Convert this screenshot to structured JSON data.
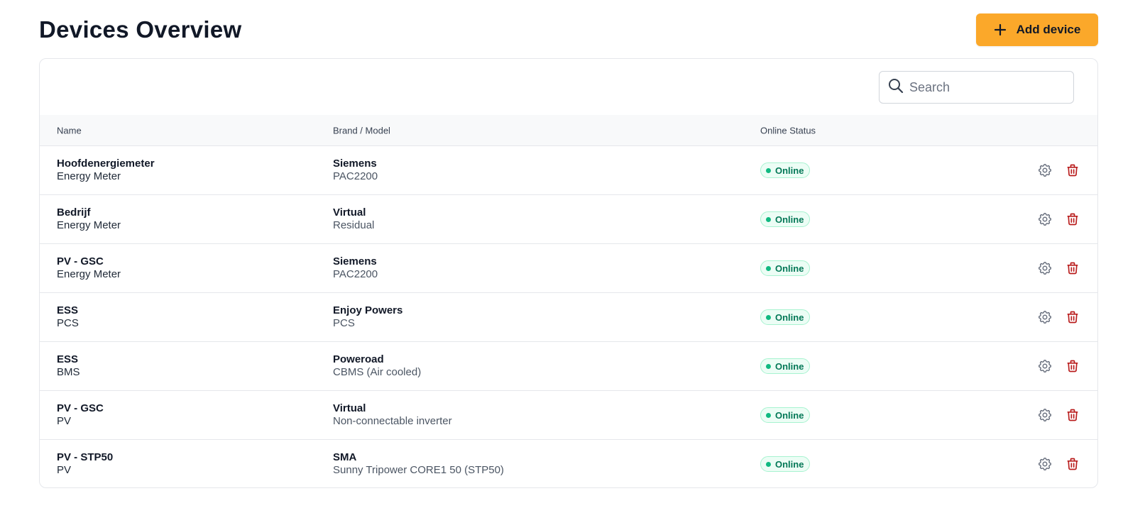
{
  "page": {
    "title": "Devices Overview",
    "add_button_label": "Add device"
  },
  "search": {
    "placeholder": "Search",
    "value": ""
  },
  "table": {
    "headers": {
      "name": "Name",
      "brand_model": "Brand / Model",
      "online_status": "Online Status"
    },
    "rows": [
      {
        "name": "Hoofdenergiemeter",
        "type": "Energy Meter",
        "brand": "Siemens",
        "model": "PAC2200",
        "status": "Online"
      },
      {
        "name": "Bedrijf",
        "type": "Energy Meter",
        "brand": "Virtual",
        "model": "Residual",
        "status": "Online"
      },
      {
        "name": "PV - GSC",
        "type": "Energy Meter",
        "brand": "Siemens",
        "model": "PAC2200",
        "status": "Online"
      },
      {
        "name": "ESS",
        "type": "PCS",
        "brand": "Enjoy Powers",
        "model": "PCS",
        "status": "Online"
      },
      {
        "name": "ESS",
        "type": "BMS",
        "brand": "Poweroad",
        "model": "CBMS (Air cooled)",
        "status": "Online"
      },
      {
        "name": "PV - GSC",
        "type": "PV",
        "brand": "Virtual",
        "model": "Non-connectable inverter",
        "status": "Online"
      },
      {
        "name": "PV - STP50",
        "type": "PV",
        "brand": "SMA",
        "model": "Sunny Tripower CORE1 50 (STP50)",
        "status": "Online"
      }
    ]
  },
  "icons": {
    "add": "plus-icon",
    "search": "search-icon",
    "settings": "gear-icon",
    "delete": "trash-icon"
  },
  "colors": {
    "accent": "#fba82a",
    "online_text": "#047857",
    "online_bg": "#ecfdf5",
    "online_dot": "#10b981",
    "delete_icon": "#b91c1c",
    "settings_icon": "#6b7280"
  }
}
